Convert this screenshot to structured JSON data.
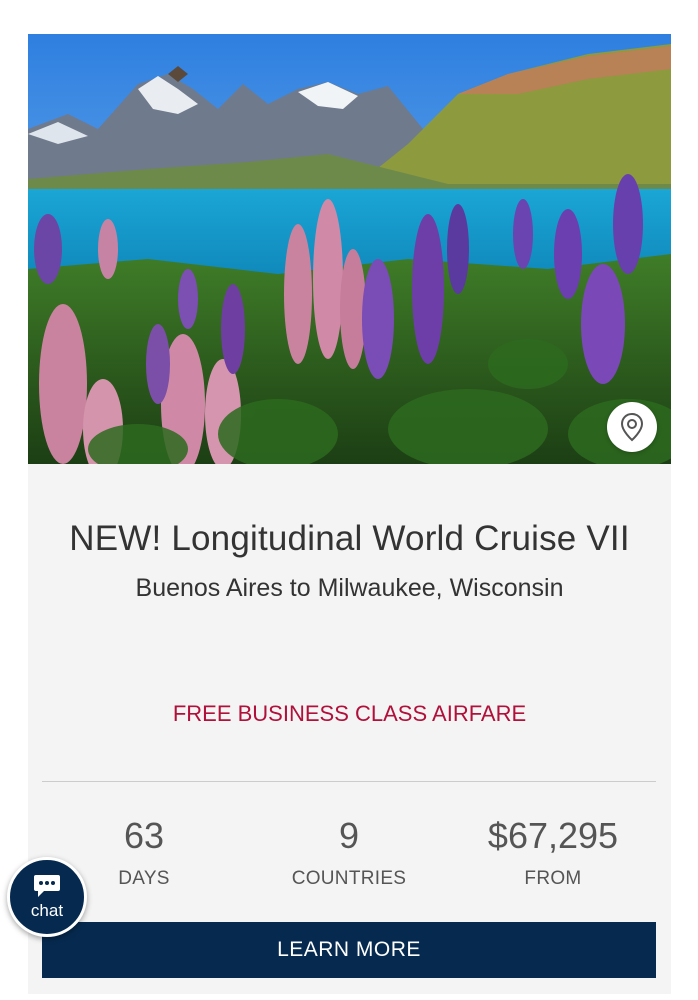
{
  "hero": {
    "image_description_icon": "landscape-photo",
    "pin_icon": "map-pin-icon"
  },
  "cruise": {
    "title": "NEW! Longitudinal World Cruise VII",
    "route": "Buenos Aires to Milwaukee, Wisconsin",
    "promo": "FREE BUSINESS CLASS AIRFARE"
  },
  "stats": [
    {
      "value": "63",
      "label": "DAYS"
    },
    {
      "value": "9",
      "label": "COUNTRIES"
    },
    {
      "value": "$67,295",
      "label": "FROM"
    }
  ],
  "cta_label": "LEARN MORE",
  "chat_label": "chat",
  "colors": {
    "promo": "#b0103a",
    "navy": "#062a4f",
    "card_bg": "#f4f4f4"
  }
}
